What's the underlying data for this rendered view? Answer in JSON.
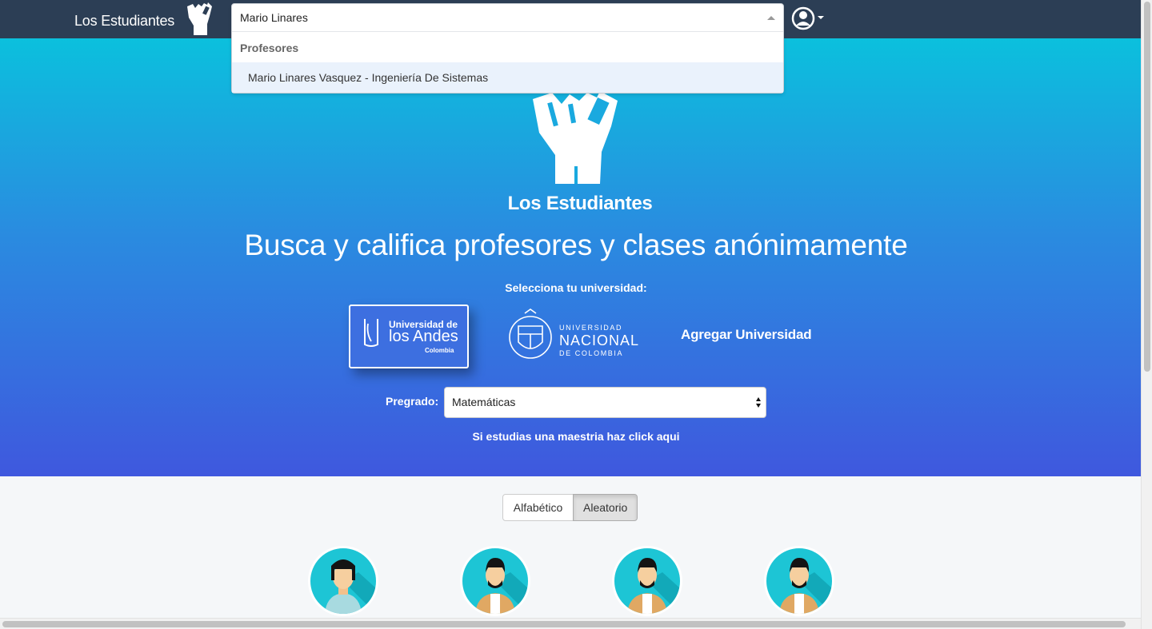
{
  "navbar": {
    "brand": "Los Estudiantes",
    "brand_icon": "raised-fist-icon",
    "user_icon": "user-circle-icon"
  },
  "search": {
    "value": "Mario Linares",
    "group_label": "Profesores",
    "results": [
      "Mario Linares Vasquez - Ingeniería De Sistemas"
    ]
  },
  "hero": {
    "brand": "Los Estudiantes",
    "title": "Busca y califica profesores y clases anónimamente",
    "select_university_label": "Selecciona tu universidad:",
    "universities": {
      "andes": {
        "line1": "Universidad de",
        "line2": "los Andes",
        "line3": "Colombia"
      },
      "nacional": {
        "line1": "UNIVERSIDAD",
        "line2": "NACIONAL",
        "line3": "DE COLOMBIA"
      }
    },
    "add_university": "Agregar Universidad",
    "pregrado_label": "Pregrado:",
    "pregrado_value": "Matemáticas",
    "maestria_link": "Si estudias una maestria haz click aqui"
  },
  "sort": {
    "options": [
      "Alfabético",
      "Aleatorio"
    ],
    "active": "Aleatorio"
  },
  "colors": {
    "navbar": "#2c3e55",
    "hero_top": "#0bc0dd",
    "hero_bottom": "#3f58de",
    "avatar_bg": "#1dc5d5"
  }
}
